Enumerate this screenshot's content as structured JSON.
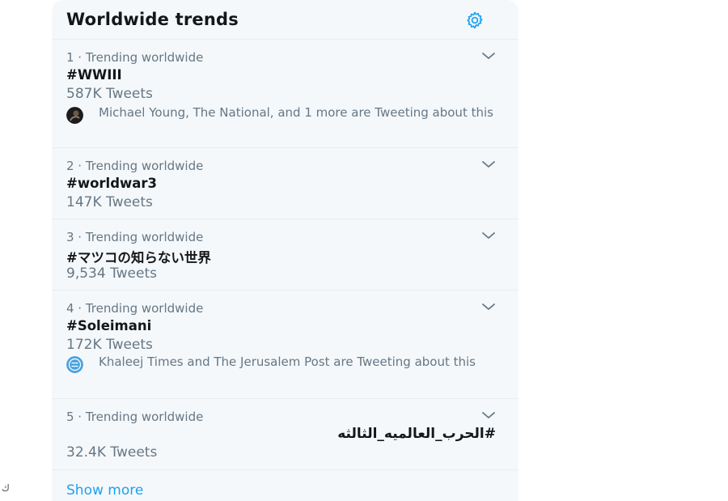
{
  "panel": {
    "title": "Worldwide trends",
    "settings_icon": "gear-icon",
    "accent_color": "#1da1f2"
  },
  "trends": [
    {
      "meta": "1 · Trending worldwide",
      "name": "#WWIII",
      "count": "587K Tweets",
      "context": "Michael Young, The National, and 1 more are Tweeting about this",
      "context_icon": "avatar-icon"
    },
    {
      "meta": "2 · Trending worldwide",
      "name": "#worldwar3",
      "count": "147K Tweets"
    },
    {
      "meta": "3 · Trending worldwide",
      "name": "#マツコの知らない世界",
      "count": "9,534 Tweets"
    },
    {
      "meta": "4 · Trending worldwide",
      "name": "#Soleimani",
      "count": "172K Tweets",
      "context": "Khaleej Times and The Jerusalem Post are Tweeting about this",
      "context_icon": "publisher-logo-icon"
    },
    {
      "meta": "5 · Trending worldwide",
      "name": "#الحرب_العالميه_الثالثه",
      "count": "32.4K Tweets"
    }
  ],
  "footer": {
    "show_more": "Show more"
  },
  "watermark": "ك"
}
